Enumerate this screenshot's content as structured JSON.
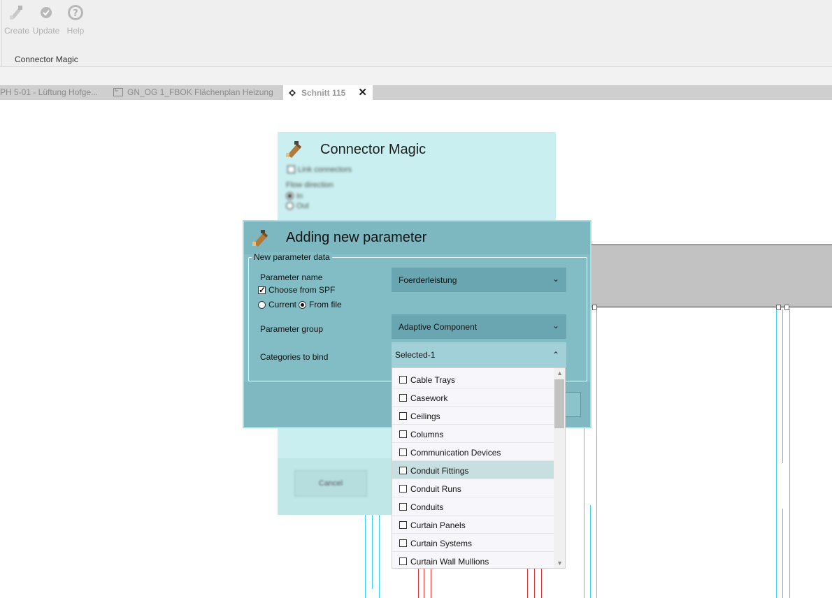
{
  "ribbon": {
    "buttons": [
      {
        "label": "Create",
        "icon": "connector-magic-icon"
      },
      {
        "label": "Update",
        "icon": "check-circle-icon"
      },
      {
        "label": "Help",
        "icon": "help-circle-icon"
      }
    ],
    "group_label": "Connector Magic"
  },
  "tabs": [
    {
      "label": "PH 5-01 - Lüftung Hofge..."
    },
    {
      "label": "GN_OG 1_FBOK Flächenplan Heizung"
    },
    {
      "label": "Schnitt 115",
      "close": "✕"
    }
  ],
  "back_dialog": {
    "title": "Connector Magic",
    "link_connectors": "Link connectors",
    "flow_direction": "Flow direction",
    "flow_in": "In",
    "flow_out": "Out",
    "cancel": "Cancel"
  },
  "dialog": {
    "title": "Adding new parameter",
    "group_title": "New parameter data",
    "parameter_name_label": "Parameter name",
    "choose_from_spf": "Choose from SPF",
    "radio_current": "Current",
    "radio_from_file": "From file",
    "parameter_name_value": "Foerderleistung",
    "parameter_group_label": "Parameter group",
    "parameter_group_value": "Adaptive Component",
    "categories_label": "Categories to bind",
    "categories_value": "Selected-1"
  },
  "categories": [
    "Cable Trays",
    "Casework",
    "Ceilings",
    "Columns",
    "Communication Devices",
    "Conduit Fittings",
    "Conduit Runs",
    "Conduits",
    "Curtain Panels",
    "Curtain Systems",
    "Curtain Wall Mullions"
  ],
  "highlighted_category": "Conduit Fittings",
  "colors": {
    "dialog_back": "#c9eff0",
    "dialog_front": "#87bfc8",
    "cyan_lines": "#33d6e8",
    "red_lines": "#e23a3a"
  }
}
